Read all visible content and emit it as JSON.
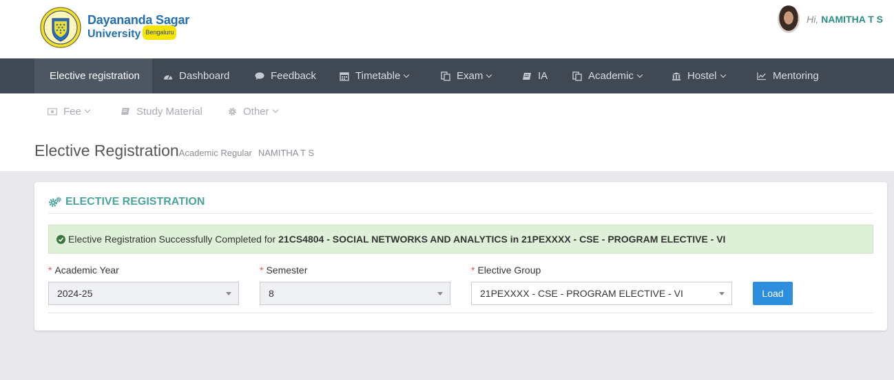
{
  "brand": {
    "line1": "Dayananda Sagar",
    "line2": "University",
    "badge": "Bengaluru"
  },
  "user": {
    "greeting": "Hi,",
    "name": "NAMITHA T S"
  },
  "nav": {
    "items": [
      {
        "label": "Elective registration",
        "icon": ""
      },
      {
        "label": "Dashboard",
        "icon": "dashboard-icon"
      },
      {
        "label": "Feedback",
        "icon": "comment-icon"
      },
      {
        "label": "Timetable",
        "icon": "calendar-icon"
      },
      {
        "label": "Exam",
        "icon": "copy-icon"
      },
      {
        "label": "IA",
        "icon": "book-icon"
      },
      {
        "label": "Academic",
        "icon": "copy-icon"
      },
      {
        "label": "Hostel",
        "icon": "building-icon"
      },
      {
        "label": "Mentoring",
        "icon": "line-chart-icon"
      }
    ]
  },
  "subnav": {
    "items": [
      {
        "label": "Fee",
        "icon": "money-icon"
      },
      {
        "label": "Study Material",
        "icon": "book-icon"
      },
      {
        "label": "Other",
        "icon": "gear-icon"
      }
    ]
  },
  "page": {
    "title": "Elective Registration",
    "meta1": "Academic Regular",
    "meta2": "NAMITHA T S"
  },
  "card": {
    "title": "ELECTIVE REGISTRATION",
    "alert_text": "Elective Registration Successfully Completed for",
    "alert_bold": "21CS4804 - SOCIAL NETWORKS AND ANALYTICS in 21PEXXXX - CSE - PROGRAM ELECTIVE - VI",
    "fields": {
      "academic_year": {
        "label": "Academic Year",
        "value": "2024-25"
      },
      "semester": {
        "label": "Semester",
        "value": "8"
      },
      "elective_group": {
        "label": "Elective Group",
        "value": "21PEXXXX - CSE - PROGRAM ELECTIVE - VI"
      }
    },
    "load_label": "Load"
  },
  "colors": {
    "nav_bg": "#3f4853",
    "accent_teal": "#4aa49c",
    "button_blue": "#2e8ede",
    "alert_bg": "#dff0d8"
  }
}
